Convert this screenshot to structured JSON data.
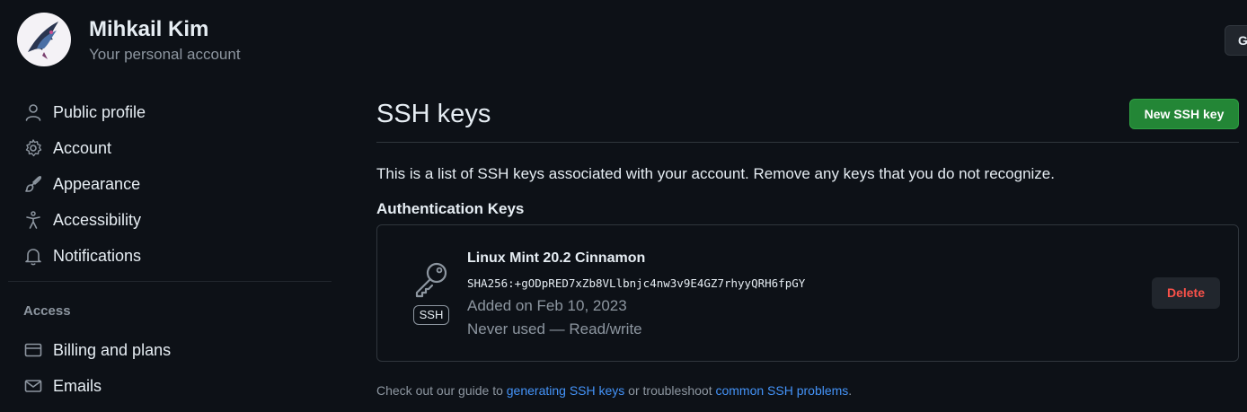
{
  "header": {
    "name": "Mihkail Kim",
    "subtitle": "Your personal account",
    "go_button": "G"
  },
  "sidebar": {
    "items": [
      {
        "label": "Public profile",
        "icon": "person-icon"
      },
      {
        "label": "Account",
        "icon": "gear-icon"
      },
      {
        "label": "Appearance",
        "icon": "paintbrush-icon"
      },
      {
        "label": "Accessibility",
        "icon": "accessibility-icon"
      },
      {
        "label": "Notifications",
        "icon": "bell-icon"
      }
    ],
    "access_heading": "Access",
    "access_items": [
      {
        "label": "Billing and plans",
        "icon": "credit-card-icon"
      },
      {
        "label": "Emails",
        "icon": "mail-icon"
      }
    ]
  },
  "main": {
    "title": "SSH keys",
    "new_key_button": "New SSH key",
    "intro": "This is a list of SSH keys associated with your account. Remove any keys that you do not recognize.",
    "auth_heading": "Authentication Keys",
    "keys": [
      {
        "title": "Linux Mint 20.2 Cinnamon",
        "fingerprint": "SHA256:+gODpRED7xZb8VLlbnjc4nw3v9E4GZ7rhyyQRH6fpGY",
        "added": "Added on Feb 10, 2023",
        "usage": "Never used — Read/write",
        "type_label": "SSH",
        "delete_label": "Delete"
      }
    ],
    "footer": {
      "prefix": "Check out our guide to ",
      "link1": "generating SSH keys",
      "middle": " or troubleshoot ",
      "link2": "common SSH problems",
      "suffix": "."
    }
  },
  "colors": {
    "background": "#0d1117",
    "primary_button": "#238636",
    "danger": "#f85149",
    "link": "#4493f8",
    "muted": "#8d96a0"
  }
}
